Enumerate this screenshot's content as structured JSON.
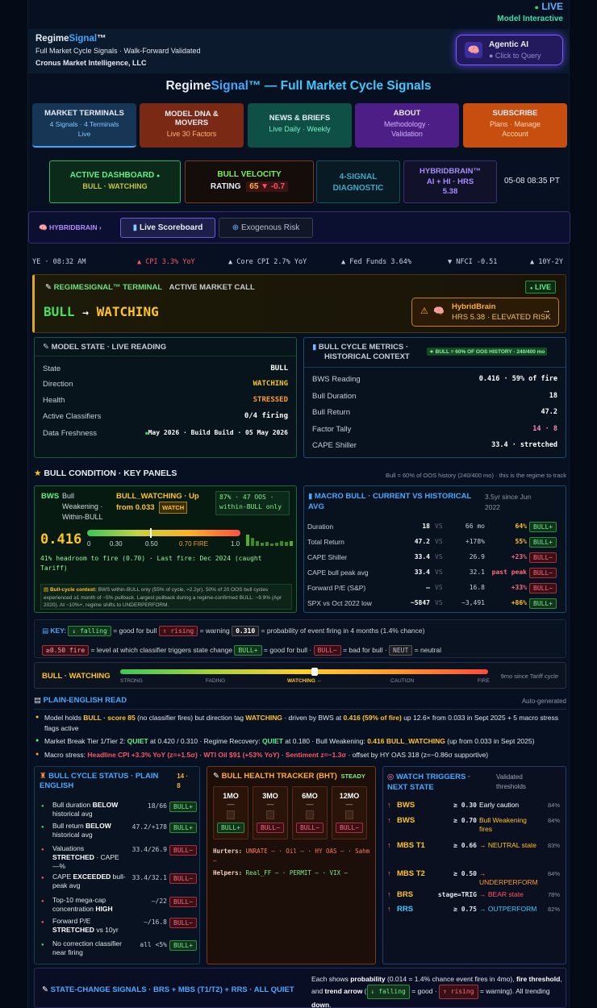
{
  "top": {
    "live": "LIVE",
    "model": "Model Interactive"
  },
  "brand": {
    "name_a": "Regime",
    "name_b": "Signal",
    "tm": "™",
    "tagline": "Full Market Cycle Signals · Walk-Forward Validated",
    "company": "Cronus Market Intelligence, LLC"
  },
  "agentic": {
    "title": "Agentic AI",
    "sub": "● Click to Query"
  },
  "main_title": {
    "a": "Regime",
    "b": "Signal",
    "c": "™ — Full Market Cycle Signals"
  },
  "nav": [
    {
      "title": "MARKET TERMINALS",
      "sub": "4 Signals · 4 Terminals",
      "sub2": "Live"
    },
    {
      "title": "MODEL DNA & MOVERS",
      "sub": "Live 30 Factors"
    },
    {
      "title": "NEWS & BRIEFS",
      "sub": "Live Daily · Weekly"
    },
    {
      "title": "ABOUT",
      "sub": "Methodology ·",
      "sub2": "Validation"
    },
    {
      "title": "SUBSCRIBE",
      "sub": "Plans · Manage",
      "sub2": "Account"
    }
  ],
  "subnav": {
    "active_title": "ACTIVE DASHBOARD",
    "active_dot": "●",
    "active_sub": "BULL · WATCHING",
    "vel_title": "BULL VELOCITY",
    "vel_label": "RATING",
    "vel_value": "65",
    "vel_delta": "▼ -0.7",
    "diag": "4-SIGNAL DIAGNOSTIC",
    "hb_title": "HYBRIDBRAIN™",
    "hb_sub": "AI + HI · HRS",
    "hb_val": "5.38",
    "time": "05-08 08:35 PT"
  },
  "tabs": {
    "crumb": "HYBRIDBRAIN ›",
    "t1": "Live Scoreboard",
    "t2": "Exogenous Risk"
  },
  "ticker": {
    "t0": "YE · 08:32 AM",
    "t1": "▲ CPI 3.3% YoY",
    "t2": "▲ Core CPI 2.7% YoY",
    "t3": "▲ Fed Funds 3.64%",
    "t4": "▼ NFCI -0.51",
    "t5": "▲ 10Y-2Y"
  },
  "terminal": {
    "head": "REGIMESIGNAL™ TERMINAL",
    "head2": "ACTIVE MARKET CALL",
    "live": "LIVE",
    "state": "BULL",
    "arrow": "→",
    "dir": "WATCHING",
    "hb_title": "HybridBrain",
    "hb_sub": "HRS 5.38 · ELEVATED RISK",
    "hb_arrow": "→"
  },
  "model_state": {
    "title": "MODEL STATE · LIVE READING",
    "rows": [
      [
        "State",
        "BULL"
      ],
      [
        "Direction",
        "WATCHING"
      ],
      [
        "Health",
        "STRESSED"
      ],
      [
        "Active Classifiers",
        "0/4 firing"
      ],
      [
        "Data Freshness",
        "May 2026 · Build Build · 05 May 2026"
      ]
    ]
  },
  "metrics": {
    "title": "BULL CYCLE METRICS ·",
    "title2": "HISTORICAL CONTEXT",
    "badge": "★ BULL = 60% OF OOS HISTORY · 240/400 mo",
    "rows": [
      [
        "BWS Reading",
        "0.416 · 59% of fire"
      ],
      [
        "Bull Duration",
        "18"
      ],
      [
        "Bull Return",
        "47.2"
      ],
      [
        "Factor Tally",
        "14 · 8"
      ],
      [
        "CAPE Shiller",
        "33.4 · stretched"
      ]
    ]
  },
  "cond": {
    "title": "BULL CONDITION · KEY PANELS",
    "note": "Bull = 60% of OOS history (240/400 mo) · this is the regime to track"
  },
  "bws": {
    "label": "BWS",
    "l2": "Bull",
    "l3": "Weakening ·",
    "l4": "Within-BULL",
    "status": "BULL_WATCHING · Up",
    "status2": "from 0.033",
    "watch": "WATCH",
    "oos": "87% · 47 OOS ·",
    "oos2": "within-BULL only",
    "value": "0.416",
    "ticks": [
      "0",
      "0.30",
      "0.50",
      "0.70 FIRE",
      "1.0"
    ],
    "headroom": "41% headroom to fire (0.70) · Last fire: Dec 2024 (caught Tariff)",
    "ctx_b": "Bull-cycle context:",
    "ctx": " BWS within-BULL only (55% of cycle, ≈2.2yr). 50% of 20 OOS bull cycles experienced ≥1 month of ~5% pullback. Largest pullback during a regime-confirmed BULL: ~9.9% (Apr 2020). At ~10%+, regime shifts to UNDERPERFORM."
  },
  "macro": {
    "title": "MACRO BULL · CURRENT VS HISTORICAL",
    "title2": "AVG",
    "since": "3.5yr since Jun",
    "since2": "2022",
    "rows": [
      [
        "Duration",
        "18",
        "VS",
        "66 mo",
        "64%",
        "BULL+",
        "g"
      ],
      [
        "Total Return",
        "47.2",
        "VS",
        "+178%",
        "55%",
        "BULL+",
        "g"
      ],
      [
        "CAPE Shiller",
        "33.4",
        "VS",
        "26.9",
        "+23%",
        "BULL−",
        "b"
      ],
      [
        "CAPE bull peak avg",
        "33.4",
        "VS",
        "32.1",
        "past peak",
        "BULL−",
        "b"
      ],
      [
        "Forward P/E (S&P)",
        "—",
        "VS",
        "16.8",
        "+33%",
        "BULL−",
        "b"
      ],
      [
        "SPX vs Oct 2022 low",
        "~5847",
        "VS",
        "~3,491",
        "+86%",
        "BULL+",
        "g"
      ]
    ]
  },
  "key": {
    "k": "KEY:",
    "falling": "↓ falling",
    "f_t": "= good for bull",
    "rising": "↑ rising",
    "r_t": "= warning",
    "p": "0.310",
    "p_t": "= probability of event firing in 4 months (1.4% chance)",
    "fire": "≥0.50 fire",
    "fire_t": "= level at which classifier triggers state change",
    "bp": "BULL+",
    "bp_t": "= good for bull ·",
    "bm": "BULL−",
    "bm_t": "= bad for bull ·",
    "nt": "NEUT",
    "nt_t": "= neutral"
  },
  "stage": {
    "label": "BULL · WATCHING",
    "s": [
      "STRONG",
      "FADING",
      "WATCHING ←",
      "CAUTION",
      "FIRE"
    ],
    "since": "9mo since Tariff cycle"
  },
  "plain": {
    "title": "PLAIN-ENGLISH READ",
    "auto": "Auto-generated",
    "b1": "Model holds BULL · score 85 (no classifier fires) but direction tag WATCHING · driven by BWS at 0.416 (59% of fire) up 12.6× from 0.033 in Sept 2025 + 5 macro stress flags active",
    "b2": "Market Break Tier 1/Tier 2: QUIET at 0.420 / 0.310 · Regime Recovery: QUIET at 0.180 · Bull Weakening: 0.416 BULL_WATCHING (up from 0.033 in Sept 2025)",
    "b3": "Macro stress: Headline CPI +3.3% YoY (z=+1.5σ) · WTI Oil $91 (+53% YoY) · Sentiment z=−1.3σ · offset by HY OAS 318 (z=−0.86σ supportive)"
  },
  "cycle": {
    "title": "BULL CYCLE STATUS · PLAIN",
    "title2": "ENGLISH",
    "count": "14 ·",
    "count2": "8",
    "rows": [
      [
        "Bull duration BELOW historical avg",
        "18/66",
        "BULL+",
        "g"
      ],
      [
        "Bull return BELOW historical avg",
        "47.2/+178",
        "BULL+",
        "g"
      ],
      [
        "Valuations STRETCHED · CAPE —%",
        "33.4/26.9",
        "BULL−",
        "b"
      ],
      [
        "CAPE EXCEEDED bull-peak avg",
        "33.4/32.1",
        "BULL−",
        "b"
      ],
      [
        "Top-10 mega-cap concentration HIGH",
        "—/22",
        "BULL−",
        "b"
      ],
      [
        "Forward P/E STRETCHED vs 10yr",
        "—/16.8",
        "BULL−",
        "b"
      ],
      [
        "No correction classifier near firing",
        "all <5%",
        "BULL+",
        "g"
      ]
    ]
  },
  "bht": {
    "title": "BULL HEALTH TRACKER (BHT)",
    "steady": "STEADY",
    "cols": [
      [
        "1MO",
        "BULL+",
        "g"
      ],
      [
        "3MO",
        "BULL−",
        "b"
      ],
      [
        "6MO",
        "BULL−",
        "b"
      ],
      [
        "12MO",
        "BULL−",
        "b"
      ]
    ],
    "hurt_l": "Hurters:",
    "hurt": "UNRATE — · Oil — · HY OAS — · Sahm —",
    "help_l": "Helpers:",
    "help": "Real_FF — · PERMIT — · VIX —"
  },
  "watch": {
    "title": "WATCH TRIGGERS ·",
    "title2": "NEXT STATE",
    "valid": "Validated",
    "valid2": "thresholds",
    "rows": [
      [
        "BWS",
        "≥ 0.30",
        "Early caution",
        "84%",
        "w"
      ],
      [
        "BWS",
        "≥ 0.70",
        "Bull Weakening fires",
        "84%",
        "y"
      ],
      [
        "MBS T1",
        "≥ 0.66",
        "→ NEUTRAL state",
        "83%",
        "y"
      ],
      [
        "MBS T2",
        "≥ 0.50",
        "→ UNDERPERFORM",
        "84%",
        "o"
      ],
      [
        "BRS",
        "stage=TRIG",
        "→ BEAR state",
        "78%",
        "r"
      ],
      [
        "RRS",
        "≥ 0.75",
        "→ OUTPERFORM",
        "82%",
        "c"
      ]
    ]
  },
  "footer": {
    "title": "STATE-CHANGE SIGNALS · BRS + MBS (T1/T2) + RRS · ALL QUIET",
    "desc": "Each shows probability (0.014 = 1.4% chance event fires in 4mo), fire threshold, and trend arrow (↓ falling = good · ↑ rising = warning). All trending down."
  }
}
